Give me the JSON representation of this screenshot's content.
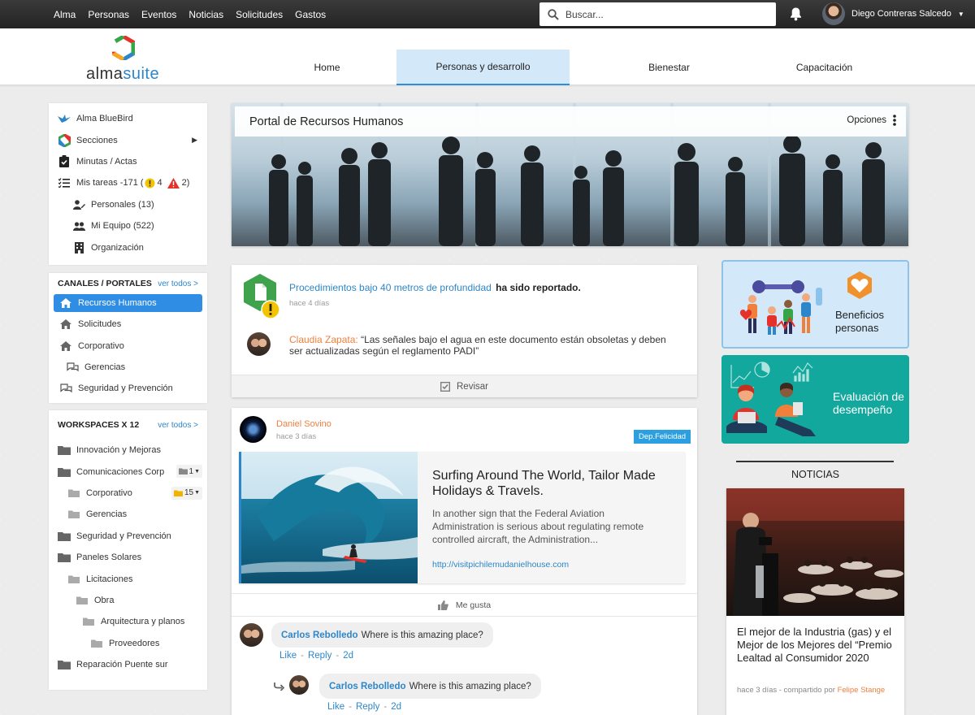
{
  "topbar": {
    "nav": [
      "Alma",
      "Personas",
      "Eventos",
      "Noticias",
      "Solicitudes",
      "Gastos"
    ],
    "search_placeholder": "Buscar...",
    "user_name": "Diego Contreras Salcedo"
  },
  "header": {
    "logo_a": "alma",
    "logo_b": "suite",
    "tabs": [
      {
        "label": "Home"
      },
      {
        "label": "Personas y desarrollo"
      },
      {
        "label": "Bienestar"
      },
      {
        "label": "Capacitación"
      }
    ]
  },
  "sidebar": {
    "top": [
      {
        "label": "Alma BlueBird"
      },
      {
        "label": "Secciones"
      },
      {
        "label": "Minutas / Actas"
      },
      {
        "label": "Mis tareas -171 ("
      },
      {
        "label": "Personales (13)"
      },
      {
        "label": "Mi Equipo (522)"
      },
      {
        "label": "Organización"
      }
    ],
    "tasks_warn": "4",
    "tasks_alert": "2)",
    "channels_title": "CANALES / PORTALES",
    "channels_more": "ver todos >",
    "channels": [
      {
        "label": "Recursos Humanos"
      },
      {
        "label": "Solicitudes"
      },
      {
        "label": "Corporativo"
      },
      {
        "label": "Gerencias"
      },
      {
        "label": "Seguridad y Prevención"
      }
    ],
    "workspaces_title": "WORKSPACES X 12",
    "workspaces_more": "ver todos >",
    "workspaces": [
      {
        "label": "Innovación y Mejoras"
      },
      {
        "label": "Comunicaciones Corp",
        "badge": "1"
      },
      {
        "label": "Corporativo",
        "badge": "15"
      },
      {
        "label": "Gerencias"
      },
      {
        "label": "Seguridad y Prevención"
      },
      {
        "label": "Paneles Solares"
      },
      {
        "label": "Licitaciones"
      },
      {
        "label": "Obra"
      },
      {
        "label": "Arquitectura y planos"
      },
      {
        "label": "Proveedores"
      },
      {
        "label": "Reparación Puente sur"
      }
    ]
  },
  "portal": {
    "title": "Portal de Recursos Humanos",
    "options": "Opciones"
  },
  "report": {
    "doc_link": "Procedimientos bajo 40 metros de profundidad",
    "suffix": "ha sido reportado.",
    "time": "hace 4 días",
    "commenter": "Claudia Zapata:",
    "comment": "“Las señales bajo el agua en este documento están obsoletas y deben ser actualizadas según el reglamento PADI”",
    "action": "Revisar"
  },
  "post": {
    "author": "Daniel Sovino",
    "time": "hace 3 días",
    "tag": "Dep.Felicidad",
    "title": "Surfing Around The World, Tailor Made Holidays & Travels.",
    "excerpt": "In another sign that the Federal Aviation Administration is serious about regulating remote controlled aircraft, the Administration...",
    "url": "http://visitpichilemudanielhouse.com",
    "like": "Me gusta",
    "comments": [
      {
        "name": "Carlos Rebolledo",
        "text": "Where is this amazing place?",
        "like": "Like",
        "reply": "Reply",
        "age": "2d"
      },
      {
        "name": "Carlos Rebolledo",
        "text": "Where is this amazing place?",
        "like": "Like",
        "reply": "Reply",
        "age": "2d"
      }
    ]
  },
  "widgets": {
    "benefits": "Beneficios personas",
    "evaluation": "Evaluación de desempeño"
  },
  "news": {
    "heading": "NOTICIAS",
    "title": "El mejor de la Industria (gas) y el Mejor de los Mejores del “Premio Lealtad al Consumidor 2020",
    "meta": "hace 3 días - compartido por",
    "author": "Felipe Stange"
  },
  "colors": {
    "accent": "#2f8de4",
    "orange": "#f07f3c",
    "teal": "#13a89e",
    "light_blue": "#d3e8f8"
  }
}
